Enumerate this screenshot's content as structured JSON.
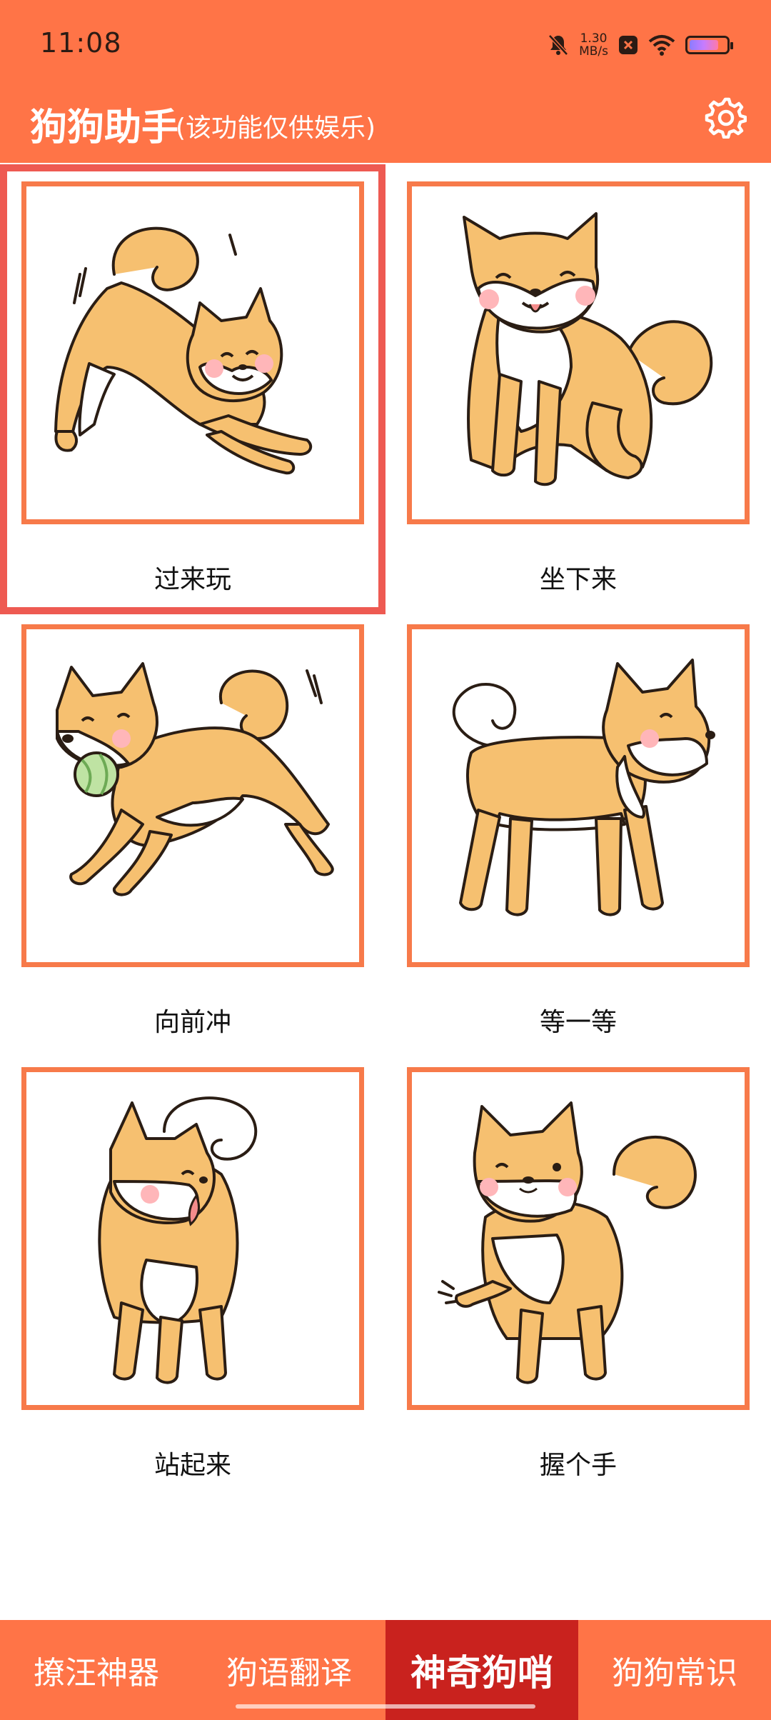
{
  "status_bar": {
    "time": "11:08",
    "speed_value": "1.30",
    "speed_unit": "MB/s",
    "icons": [
      "mute-bell-icon",
      "network-speed",
      "notification-x-icon",
      "wifi-icon",
      "battery-icon"
    ],
    "battery_level": 0.8
  },
  "header": {
    "title": "狗狗助手",
    "subtitle": "(该功能仅供娱乐)",
    "settings_icon": "gear-icon"
  },
  "commands": [
    {
      "label": "过来玩",
      "selected": true
    },
    {
      "label": "坐下来",
      "selected": false
    },
    {
      "label": "向前冲",
      "selected": false
    },
    {
      "label": "等一等",
      "selected": false
    },
    {
      "label": "站起来",
      "selected": false
    },
    {
      "label": "握个手",
      "selected": false
    }
  ],
  "bottom_nav": {
    "tabs": [
      {
        "label": "撩汪神器",
        "active": false
      },
      {
        "label": "狗语翻译",
        "active": false
      },
      {
        "label": "神奇狗哨",
        "active": true
      },
      {
        "label": "狗狗常识",
        "active": false
      }
    ]
  },
  "colors": {
    "primary_orange": "#FF7447",
    "active_tab_red": "#C9221E",
    "selected_outline": "#EE5A52",
    "frame_orange": "#F77A4A",
    "shiba_fur": "#F6C070",
    "shiba_white": "#FFFFFF",
    "blush": "#FFB6B9"
  }
}
